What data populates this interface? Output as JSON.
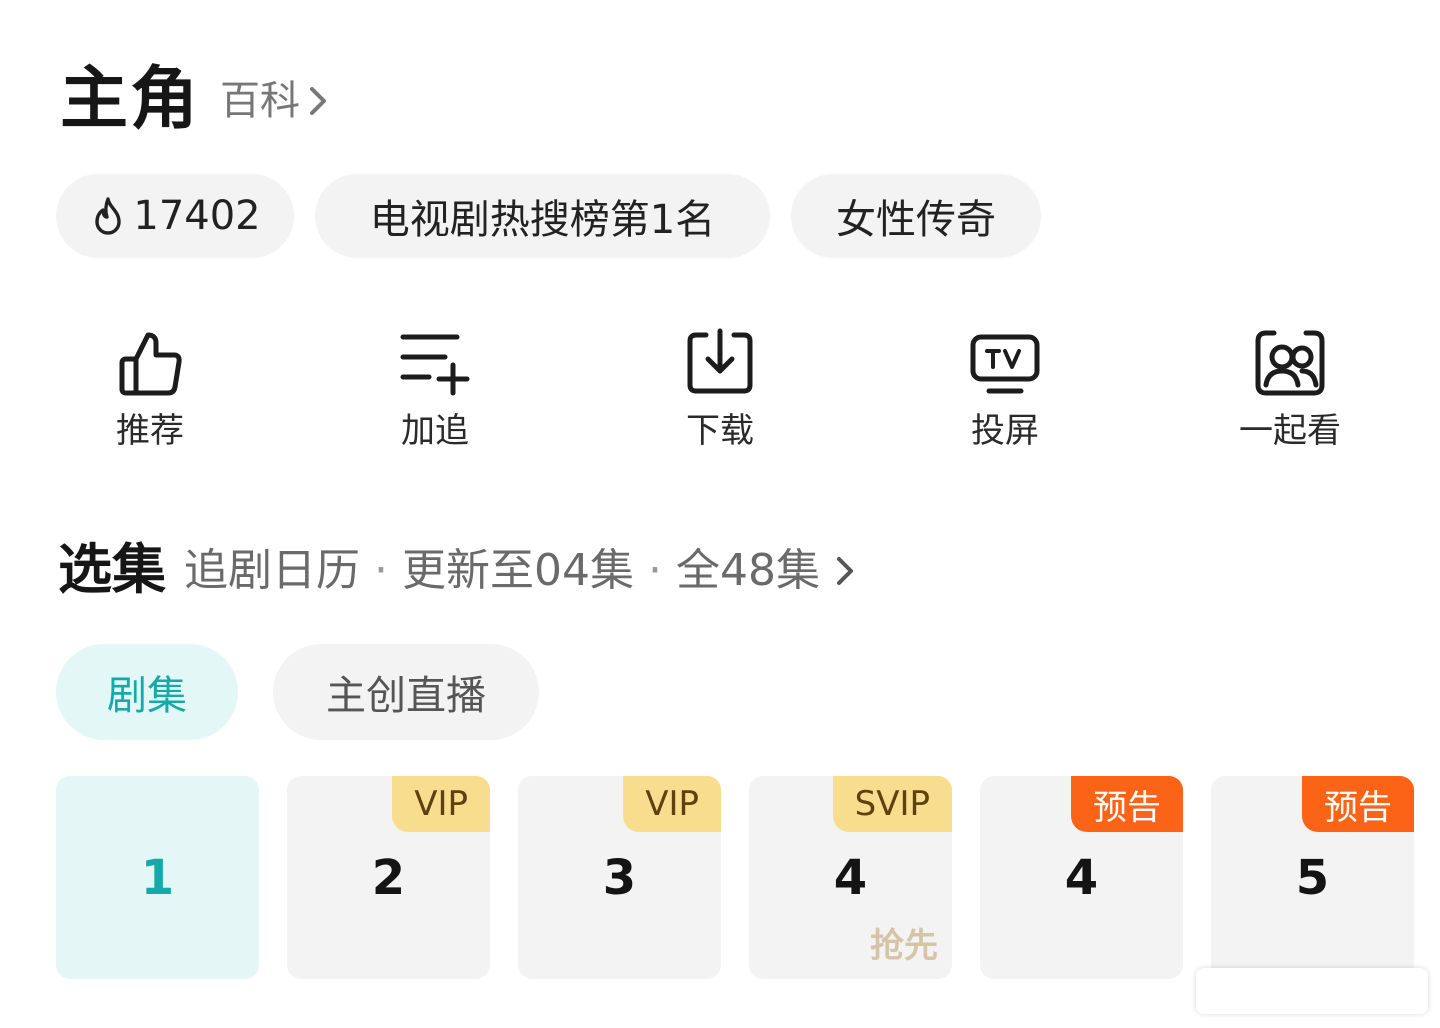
{
  "header": {
    "title": "主角",
    "baike_label": "百科"
  },
  "tags": [
    {
      "icon": "flame-icon",
      "label": "17402"
    },
    {
      "label": "电视剧热搜榜第1名"
    },
    {
      "label": "女性传奇"
    }
  ],
  "actions": [
    {
      "icon": "thumbs-up-icon",
      "label": "推荐"
    },
    {
      "icon": "playlist-add-icon",
      "label": "加追"
    },
    {
      "icon": "download-icon",
      "label": "下载"
    },
    {
      "icon": "tv-cast-icon",
      "label": "投屏"
    },
    {
      "icon": "watch-together-icon",
      "label": "一起看"
    }
  ],
  "episodes_section": {
    "title": "选集",
    "calendar_label": "追剧日历",
    "update_label": "更新至04集",
    "total_label": "全48集",
    "separator": "·"
  },
  "tabs": [
    {
      "label": "剧集",
      "active": true
    },
    {
      "label": "主创直播",
      "active": false
    }
  ],
  "episodes": [
    {
      "number": "1",
      "badge": "",
      "note": "",
      "active": true
    },
    {
      "number": "2",
      "badge": "VIP",
      "note": ""
    },
    {
      "number": "3",
      "badge": "VIP",
      "note": ""
    },
    {
      "number": "4",
      "badge": "SVIP",
      "note": "抢先"
    },
    {
      "number": "4",
      "badge": "预告",
      "note": ""
    },
    {
      "number": "5",
      "badge": "预告",
      "note": ""
    }
  ],
  "colors": {
    "accent": "#15a9a9",
    "accent_bg": "#e3f7f6",
    "vip_badge": "#f8dd8f",
    "preview_badge": "#fb6316",
    "chip_bg": "#f3f3f3"
  }
}
